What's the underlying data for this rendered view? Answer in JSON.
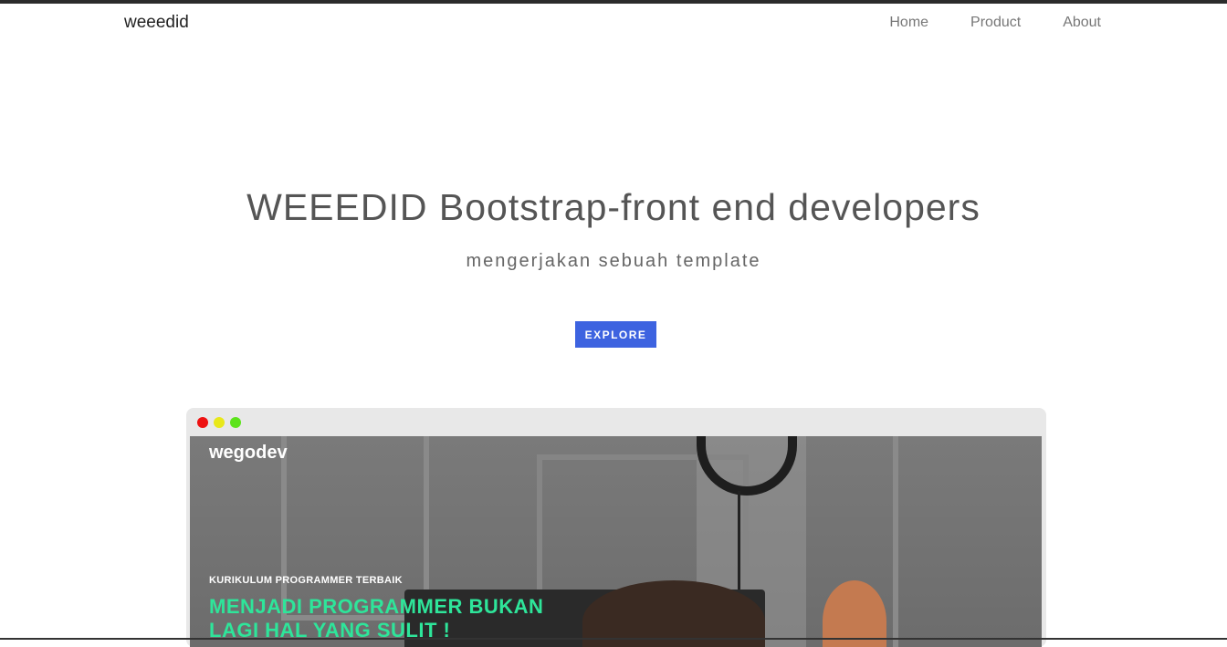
{
  "navbar": {
    "brand": "weeedid",
    "links": [
      "Home",
      "Product",
      "About"
    ]
  },
  "hero": {
    "title_strong": "WEEEDID",
    "title_rest": " Bootstrap-front end developers",
    "subtitle": "mengerjakan sebuah template",
    "button_label": "EXPLORE",
    "button_color": "#3d63e0"
  },
  "preview": {
    "logo": "wegodev",
    "kicker": "KURIKULUM PROGRAMMER TERBAIK",
    "headline": "MENJADI PROGRAMMER BUKAN LAGI HAL YANG SULIT !",
    "headline_color": "#2ee59a",
    "window_dots": [
      "red",
      "yellow",
      "green"
    ]
  }
}
